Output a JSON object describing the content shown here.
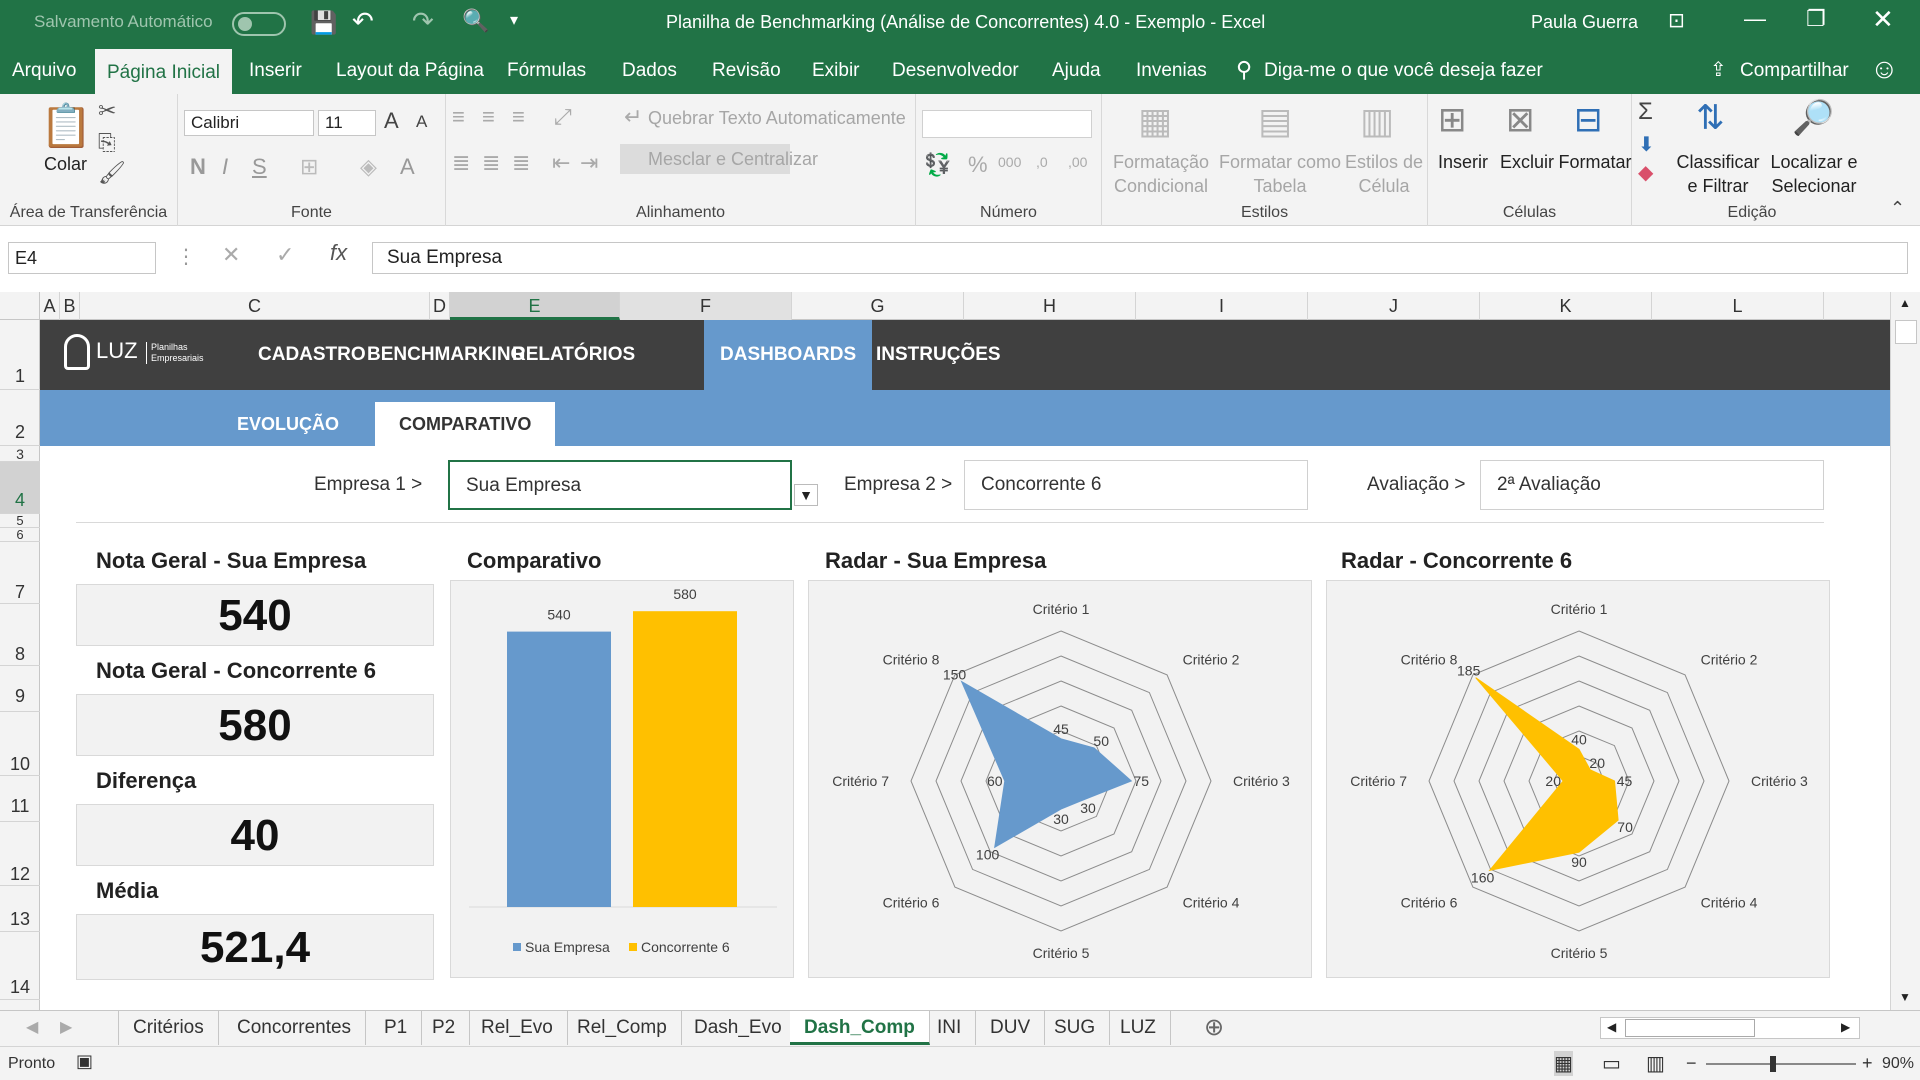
{
  "titlebar": {
    "autosave_label": "Salvamento Automático",
    "title": "Planilha de Benchmarking (Análise de Concorrentes) 4.0 - Exemplo  -  Excel",
    "user": "Paula Guerra"
  },
  "ribbon_tabs": [
    "Arquivo",
    "Página Inicial",
    "Inserir",
    "Layout da Página",
    "Fórmulas",
    "Dados",
    "Revisão",
    "Exibir",
    "Desenvolvedor",
    "Ajuda",
    "Invenias"
  ],
  "tell_me": "Diga-me o que você deseja fazer",
  "share_label": "Compartilhar",
  "ribbon": {
    "clipboard": {
      "paste": "Colar",
      "group": "Área de Transferência"
    },
    "font": {
      "name": "Calibri",
      "size": "11",
      "group": "Fonte"
    },
    "alignment": {
      "wrap": "Quebrar Texto Automaticamente",
      "merge": "Mesclar e Centralizar",
      "group": "Alinhamento"
    },
    "number": {
      "group": "Número"
    },
    "styles": {
      "cond_line1": "Formatação",
      "cond_line2": "Condicional",
      "table_line1": "Formatar como",
      "table_line2": "Tabela",
      "cell_line1": "Estilos de",
      "cell_line2": "Célula",
      "group": "Estilos"
    },
    "cells": {
      "insert": "Inserir",
      "delete": "Excluir",
      "format": "Formatar",
      "group": "Células"
    },
    "editing": {
      "sort_line1": "Classificar",
      "sort_line2": "e Filtrar",
      "find_line1": "Localizar e",
      "find_line2": "Selecionar",
      "group": "Edição"
    }
  },
  "formula_bar": {
    "name_box": "E4",
    "formula": "Sua Empresa"
  },
  "columns": [
    "A",
    "B",
    "C",
    "D",
    "E",
    "F",
    "G",
    "H",
    "I",
    "J",
    "K",
    "L"
  ],
  "rows": [
    "1",
    "2",
    "3",
    "4",
    "5",
    "6",
    "7",
    "8",
    "9",
    "10",
    "11",
    "12",
    "13",
    "14"
  ],
  "dashboard": {
    "logo_text": "LUZ",
    "logo_sub": "Planilhas Empresariais",
    "nav": [
      "CADASTRO",
      "BENCHMARKING",
      "RELATÓRIOS",
      "DASHBOARDS",
      "INSTRUÇÕES"
    ],
    "subnav": [
      "EVOLUÇÃO",
      "COMPARATIVO"
    ],
    "filters": {
      "empresa1_label": "Empresa 1 >",
      "empresa1_value": "Sua Empresa",
      "empresa2_label": "Empresa 2 >",
      "empresa2_value": "Concorrente 6",
      "avaliacao_label": "Avaliação >",
      "avaliacao_value": "2ª Avaliação"
    },
    "kpis": {
      "nota1_title": "Nota Geral - Sua Empresa",
      "nota1_value": "540",
      "nota2_title": "Nota Geral - Concorrente 6",
      "nota2_value": "580",
      "diff_title": "Diferença",
      "diff_value": "40",
      "media_title": "Média",
      "media_value": "521,4"
    },
    "chart_titles": {
      "comparativo": "Comparativo",
      "radar1": "Radar - Sua Empresa",
      "radar2": "Radar - Concorrente 6"
    }
  },
  "chart_data": [
    {
      "type": "bar",
      "title": "Comparativo",
      "categories": [
        "Sua Empresa",
        "Concorrente 6"
      ],
      "values": [
        540,
        580
      ],
      "colors": [
        "#6699cc",
        "#ffc000"
      ],
      "legend": [
        "Sua Empresa",
        "Concorrente 6"
      ],
      "ylim": [
        0,
        600
      ]
    },
    {
      "type": "radar",
      "title": "Radar - Sua Empresa",
      "categories": [
        "Critério 1",
        "Critério 2",
        "Critério 3",
        "Critério 4",
        "Critério 5",
        "Critério 6",
        "Critério 7",
        "Critério 8"
      ],
      "values": [
        45,
        50,
        75,
        30,
        30,
        100,
        60,
        150
      ],
      "data_labels": [
        "45",
        "50",
        "75",
        "30",
        "30",
        "100",
        "60",
        "150"
      ],
      "color": "#6699cc",
      "max": 160
    },
    {
      "type": "radar",
      "title": "Radar - Concorrente 6",
      "categories": [
        "Critério 1",
        "Critério 2",
        "Critério 3",
        "Critério 4",
        "Critério 5",
        "Critério 6",
        "Critério 7",
        "Critério 8"
      ],
      "values": [
        40,
        20,
        45,
        70,
        90,
        160,
        20,
        185
      ],
      "data_labels": [
        "40",
        "20",
        "45",
        "70",
        "90",
        "160",
        "20",
        "185"
      ],
      "color": "#ffc000",
      "max": 190
    }
  ],
  "sheet_tabs": [
    "Critérios",
    "Concorrentes",
    "P1",
    "P2",
    "Rel_Evo",
    "Rel_Comp",
    "Dash_Evo",
    "Dash_Comp",
    "INI",
    "DUV",
    "SUG",
    "LUZ"
  ],
  "active_sheet": "Dash_Comp",
  "status": {
    "ready": "Pronto",
    "zoom": "90%"
  },
  "colors": {
    "excel_green": "#217346",
    "nav_dark": "#404040",
    "accent_blue": "#6699cc",
    "accent_yellow": "#ffc000"
  }
}
